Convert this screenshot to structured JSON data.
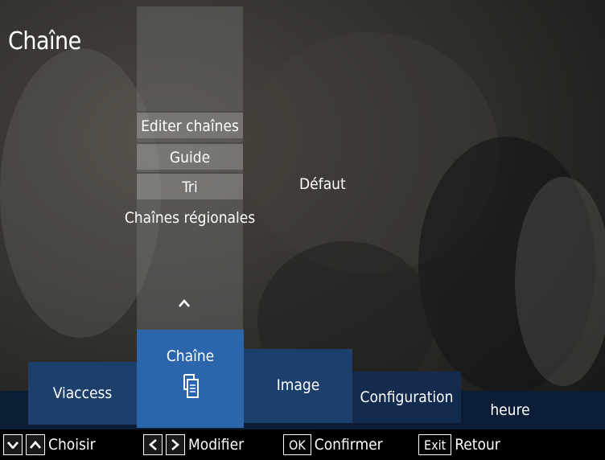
{
  "page": {
    "title": "Chaîne"
  },
  "menu": {
    "items": [
      {
        "label": "Editer chaînes"
      },
      {
        "label": "Guide"
      },
      {
        "label": "Tri"
      },
      {
        "label": "Chaînes régionales"
      }
    ],
    "tri_value": "Défaut",
    "scroll_up_glyph": "^"
  },
  "tabs": [
    {
      "label": "Viaccess"
    },
    {
      "label": "Chaîne",
      "icon": "document-copy-icon",
      "selected": true
    },
    {
      "label": "Image"
    },
    {
      "label": "Configuration"
    },
    {
      "label": "heure"
    }
  ],
  "legend": {
    "choisir": "Choisir",
    "modifier": "Modifier",
    "ok_key": "OK",
    "confirmer": "Confirmer",
    "exit_key": "Exit",
    "retour": "Retour"
  },
  "colors": {
    "selected_tab": "#2b66ad",
    "tab": "#1d3f6c",
    "band": "#0b1e38"
  }
}
